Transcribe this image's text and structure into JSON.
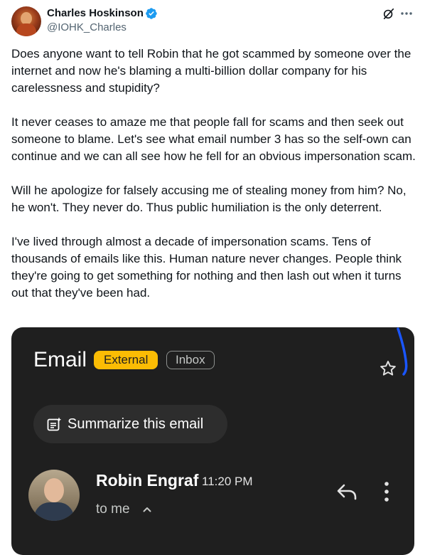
{
  "author": {
    "name": "Charles Hoskinson",
    "handle": "@IOHK_Charles",
    "verified_color": "#1d9bf0"
  },
  "icons": {
    "header_right": [
      "grok-icon",
      "more-icon"
    ],
    "email": [
      "star-icon",
      "summarize-icon",
      "chevron-up-icon",
      "reply-icon",
      "kebab-icon"
    ]
  },
  "tweet": {
    "paragraphs": [
      "Does anyone want to tell Robin that he got scammed by someone over the internet and now he's blaming a multi-billion dollar company for his carelessness and stupidity?",
      "It never ceases to amaze me that people fall for scams and then seek out someone to blame. Let's see what email number 3 has so the self-own can continue and we can all see how he fell for an obvious impersonation scam.",
      "Will he apologize for falsely accusing me of stealing money from him? No, he won't. They never do. Thus public humiliation is the only deterrent.",
      "I've lived through almost a decade of impersonation scams. Tens of thousands of emails like this. Human nature never changes. People think they're going to get something for nothing and then lash out when it turns out that they've been had."
    ]
  },
  "email_screenshot": {
    "title": "Email",
    "chip_external": "External",
    "chip_inbox": "Inbox",
    "summarize_label": "Summarize this email",
    "sender_name": "Robin Engraf",
    "sender_time": "11:20 PM",
    "recipient": "to me",
    "colors": {
      "background": "#1f1f1f",
      "external_chip": "#fbbc04",
      "scribble": "#1a56ff"
    }
  }
}
